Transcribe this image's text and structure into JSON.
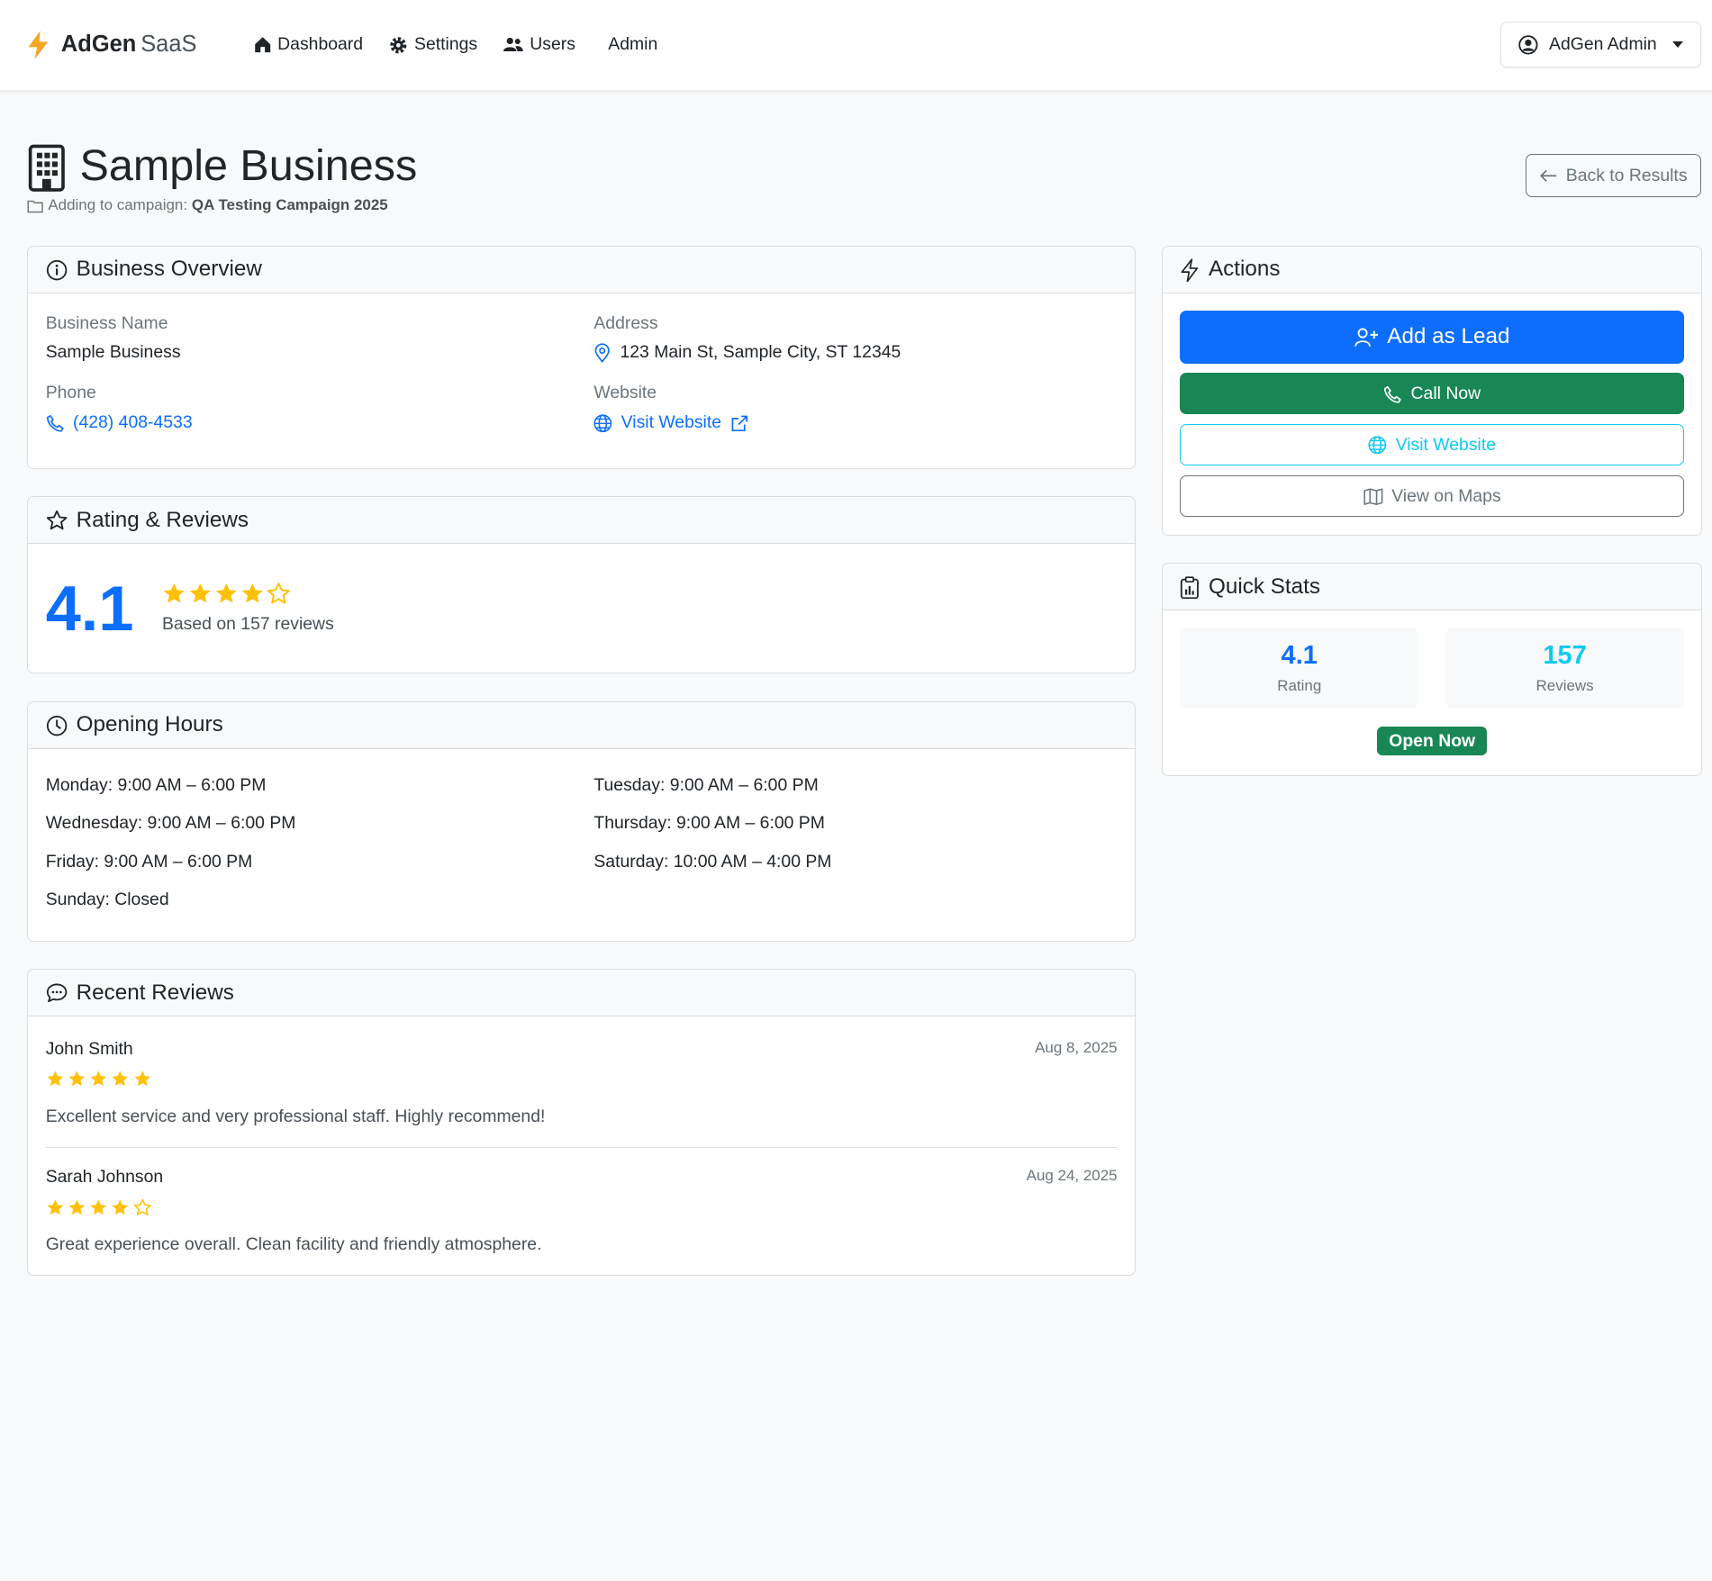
{
  "navbar": {
    "brand_strong": "AdGen",
    "brand_light": "SaaS",
    "links": [
      {
        "label": "Dashboard",
        "icon": "house-icon"
      },
      {
        "label": "Settings",
        "icon": "gear-icon"
      },
      {
        "label": "Users",
        "icon": "people-icon"
      },
      {
        "label": "Admin",
        "icon": ""
      }
    ],
    "user_menu": "AdGen Admin"
  },
  "header": {
    "title": "Sample Business",
    "subtitle_prefix": "Adding to campaign:",
    "campaign": "QA Testing Campaign 2025",
    "back_button": "Back to Results"
  },
  "overview": {
    "title": "Business Overview",
    "business_name_label": "Business Name",
    "business_name": "Sample Business",
    "address_label": "Address",
    "address": "123 Main St, Sample City, ST 12345",
    "phone_label": "Phone",
    "phone": "(428) 408-4533",
    "website_label": "Website",
    "website_link": "Visit Website"
  },
  "rating": {
    "title": "Rating & Reviews",
    "value": "4.1",
    "stars": 4,
    "stars_total": 5,
    "subtitle": "Based on 157 reviews"
  },
  "hours": {
    "title": "Opening Hours",
    "items": [
      "Monday: 9:00 AM – 6:00 PM",
      "Tuesday: 9:00 AM – 6:00 PM",
      "Wednesday: 9:00 AM – 6:00 PM",
      "Thursday: 9:00 AM – 6:00 PM",
      "Friday: 9:00 AM – 6:00 PM",
      "Saturday: 10:00 AM – 4:00 PM",
      "Sunday: Closed"
    ]
  },
  "reviews": {
    "title": "Recent Reviews",
    "items": [
      {
        "name": "John Smith",
        "date": "Aug 8, 2025",
        "stars": 5,
        "text": "Excellent service and very professional staff. Highly recommend!"
      },
      {
        "name": "Sarah Johnson",
        "date": "Aug 24, 2025",
        "stars": 4,
        "text": "Great experience overall. Clean facility and friendly atmosphere."
      }
    ]
  },
  "actions": {
    "title": "Actions",
    "add_lead": "Add as Lead",
    "call_now": "Call Now",
    "visit_website": "Visit Website",
    "view_maps": "View on Maps"
  },
  "quick_stats": {
    "title": "Quick Stats",
    "rating_value": "4.1",
    "rating_label": "Rating",
    "reviews_value": "157",
    "reviews_label": "Reviews",
    "status_badge": "Open Now"
  },
  "colors": {
    "primary": "#0d6efd",
    "success": "#198754",
    "info": "#0dcaf0",
    "secondary": "#6c757d",
    "star": "#ffc107",
    "brand_bolt": "#f5a623"
  }
}
